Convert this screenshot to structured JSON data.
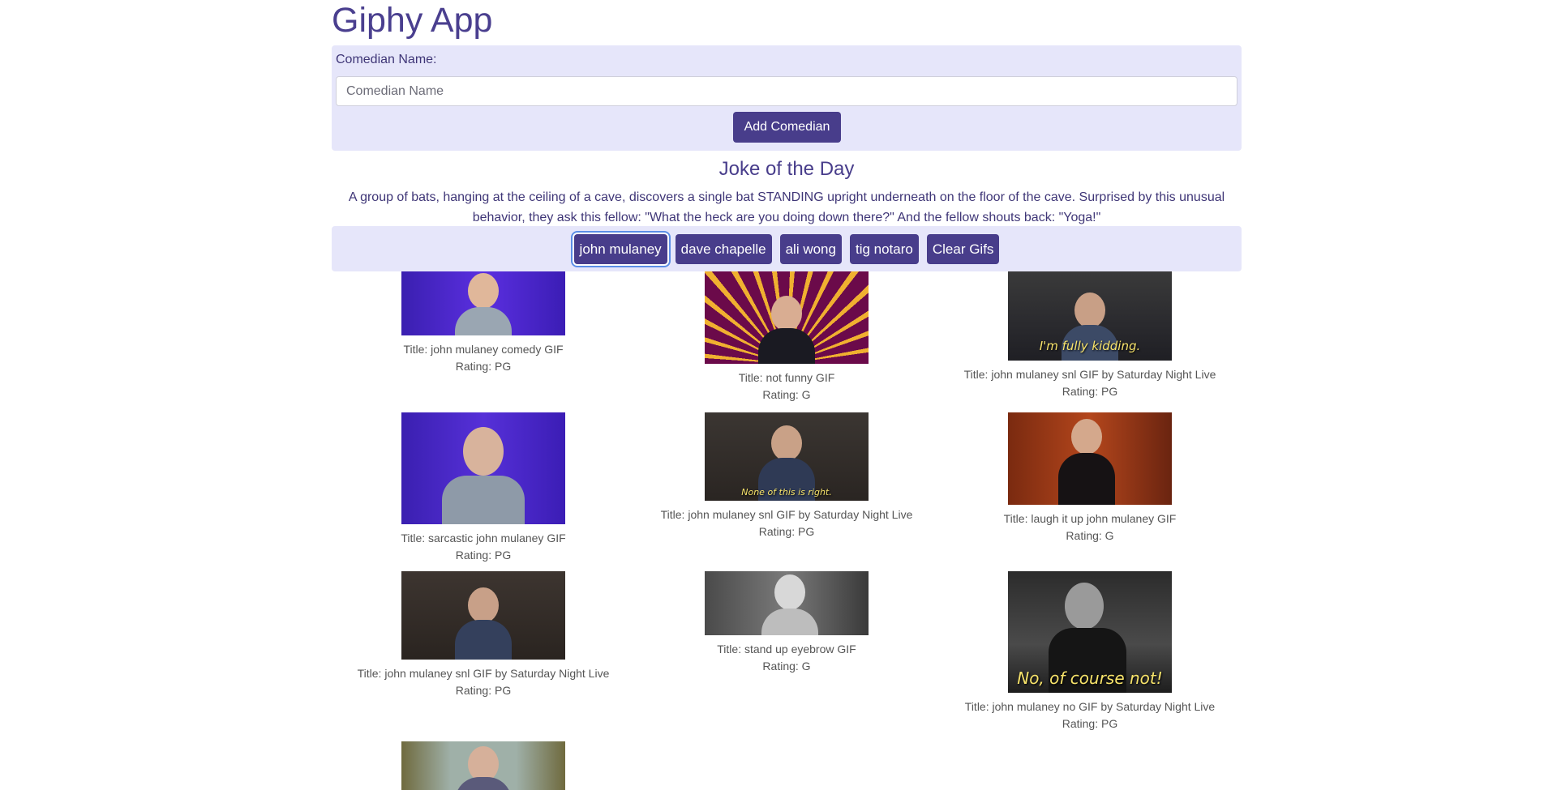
{
  "app": {
    "title": "Giphy App"
  },
  "form": {
    "label": "Comedian Name:",
    "input_placeholder": "Comedian Name",
    "input_value": "",
    "add_button_label": "Add Comedian"
  },
  "joke": {
    "heading": "Joke of the Day",
    "text": "A group of bats, hanging at the ceiling of a cave, discovers a single bat STANDING upright underneath on the floor of the cave. Surprised by this unusual behavior, they ask this fellow: \"What the heck are you doing down there?\" And the fellow shouts back: \"Yoga!\""
  },
  "tags": {
    "buttons": [
      {
        "label": "john mulaney",
        "active": true
      },
      {
        "label": "dave chapelle",
        "active": false
      },
      {
        "label": "ali wong",
        "active": false
      },
      {
        "label": "tig notaro",
        "active": false
      }
    ],
    "clear_label": "Clear Gifs"
  },
  "gifs": [
    {
      "title": "Title: john mulaney comedy GIF",
      "rating": "Rating: PG",
      "caption": ""
    },
    {
      "title": "Title: not funny GIF",
      "rating": "Rating: G",
      "caption": ""
    },
    {
      "title": "Title: john mulaney snl GIF by Saturday Night Live",
      "rating": "Rating: PG",
      "caption": "I'm fully kidding."
    },
    {
      "title": "Title: sarcastic john mulaney GIF",
      "rating": "Rating: PG",
      "caption": ""
    },
    {
      "title": "Title: john mulaney snl GIF by Saturday Night Live",
      "rating": "Rating: PG",
      "caption": "None of this is right."
    },
    {
      "title": "Title: laugh it up john mulaney GIF",
      "rating": "Rating: G",
      "caption": ""
    },
    {
      "title": "Title: john mulaney snl GIF by Saturday Night Live",
      "rating": "Rating: PG",
      "caption": ""
    },
    {
      "title": "Title: stand up eyebrow GIF",
      "rating": "Rating: G",
      "caption": ""
    },
    {
      "title": "Title: john mulaney no GIF by Saturday Night Live",
      "rating": "Rating: PG",
      "caption": "No, of course not!"
    },
    {
      "title": "",
      "rating": "",
      "caption": ""
    }
  ],
  "colors": {
    "accent": "#483d8b",
    "panel": "#e6e6fa",
    "heading": "#4a3f8f"
  }
}
